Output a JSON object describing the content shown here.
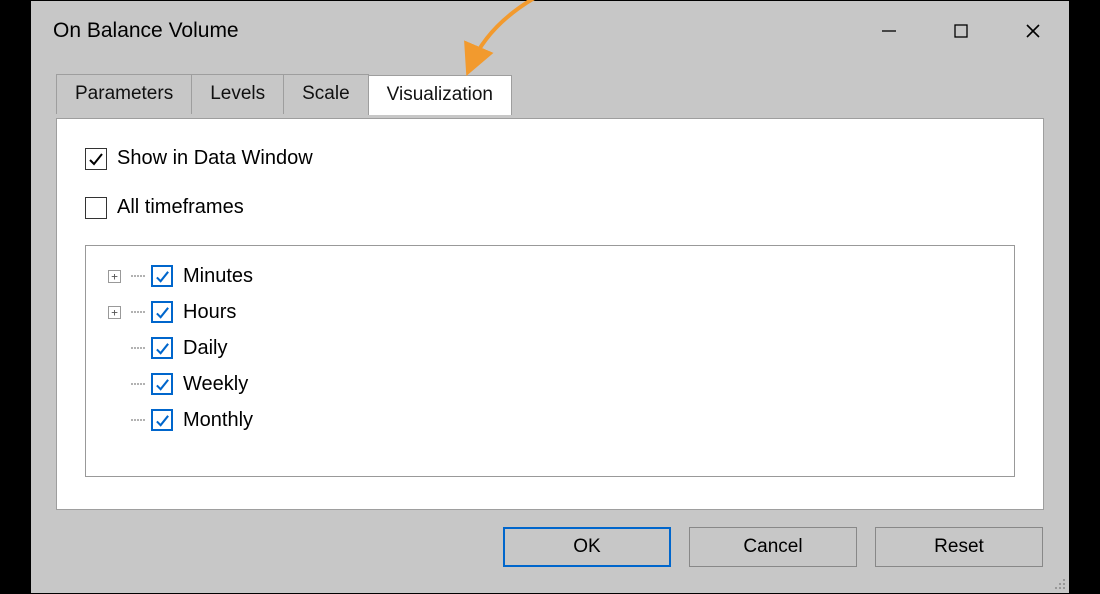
{
  "window": {
    "title": "On Balance Volume"
  },
  "tabs": [
    {
      "label": "Parameters",
      "active": false
    },
    {
      "label": "Levels",
      "active": false
    },
    {
      "label": "Scale",
      "active": false
    },
    {
      "label": "Visualization",
      "active": true
    }
  ],
  "options": {
    "show_in_data_window": {
      "label": "Show in Data Window",
      "checked": true
    },
    "all_timeframes": {
      "label": "All timeframes",
      "checked": false
    }
  },
  "timeframes": [
    {
      "label": "Minutes",
      "checked": true,
      "expandable": true
    },
    {
      "label": "Hours",
      "checked": true,
      "expandable": true
    },
    {
      "label": "Daily",
      "checked": true,
      "expandable": false
    },
    {
      "label": "Weekly",
      "checked": true,
      "expandable": false
    },
    {
      "label": "Monthly",
      "checked": true,
      "expandable": false
    }
  ],
  "buttons": {
    "ok": "OK",
    "cancel": "Cancel",
    "reset": "Reset"
  }
}
